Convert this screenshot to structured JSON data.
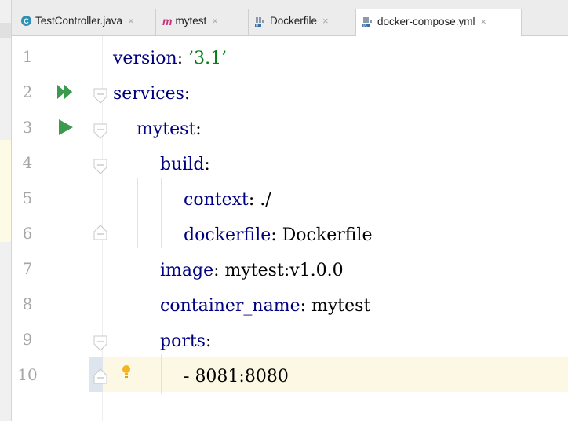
{
  "tabs": [
    {
      "label": "TestController.java",
      "icon": "java-class-icon",
      "active": false
    },
    {
      "label": "mytest",
      "icon": "maven-module-icon",
      "active": false
    },
    {
      "label": "Dockerfile",
      "icon": "dockerfile-icon",
      "active": false
    },
    {
      "label": "docker-compose.yml",
      "icon": "docker-compose-icon",
      "active": true
    }
  ],
  "close_glyph": "×",
  "icon_letters": {
    "java": "C",
    "maven": "m",
    "docker": "D",
    "compose": "DC"
  },
  "line_numbers": [
    "1",
    "2",
    "3",
    "4",
    "5",
    "6",
    "7",
    "8",
    "9",
    "10"
  ],
  "code": {
    "l1": {
      "key": "version",
      "sep": ": ",
      "val": "’3.1’"
    },
    "l2": {
      "key": "services",
      "sep": ":"
    },
    "l3": {
      "key": "mytest",
      "sep": ":"
    },
    "l4": {
      "key": "build",
      "sep": ":"
    },
    "l5": {
      "key": "context",
      "sep": ": ",
      "val": "./"
    },
    "l6": {
      "key": "dockerfile",
      "sep": ": ",
      "val": "Dockerfile"
    },
    "l7": {
      "key": "image",
      "sep": ": ",
      "val": "mytest:v1.0.0"
    },
    "l8": {
      "key": "container_name",
      "sep": ": ",
      "val": "mytest"
    },
    "l9": {
      "key": "ports",
      "sep": ":"
    },
    "l10": {
      "dash": "- ",
      "val": "8081:8080"
    }
  },
  "colors": {
    "key": "#000080",
    "string": "#067d17",
    "run": "#3c9a4e",
    "current_line": "#fdf8e3"
  }
}
